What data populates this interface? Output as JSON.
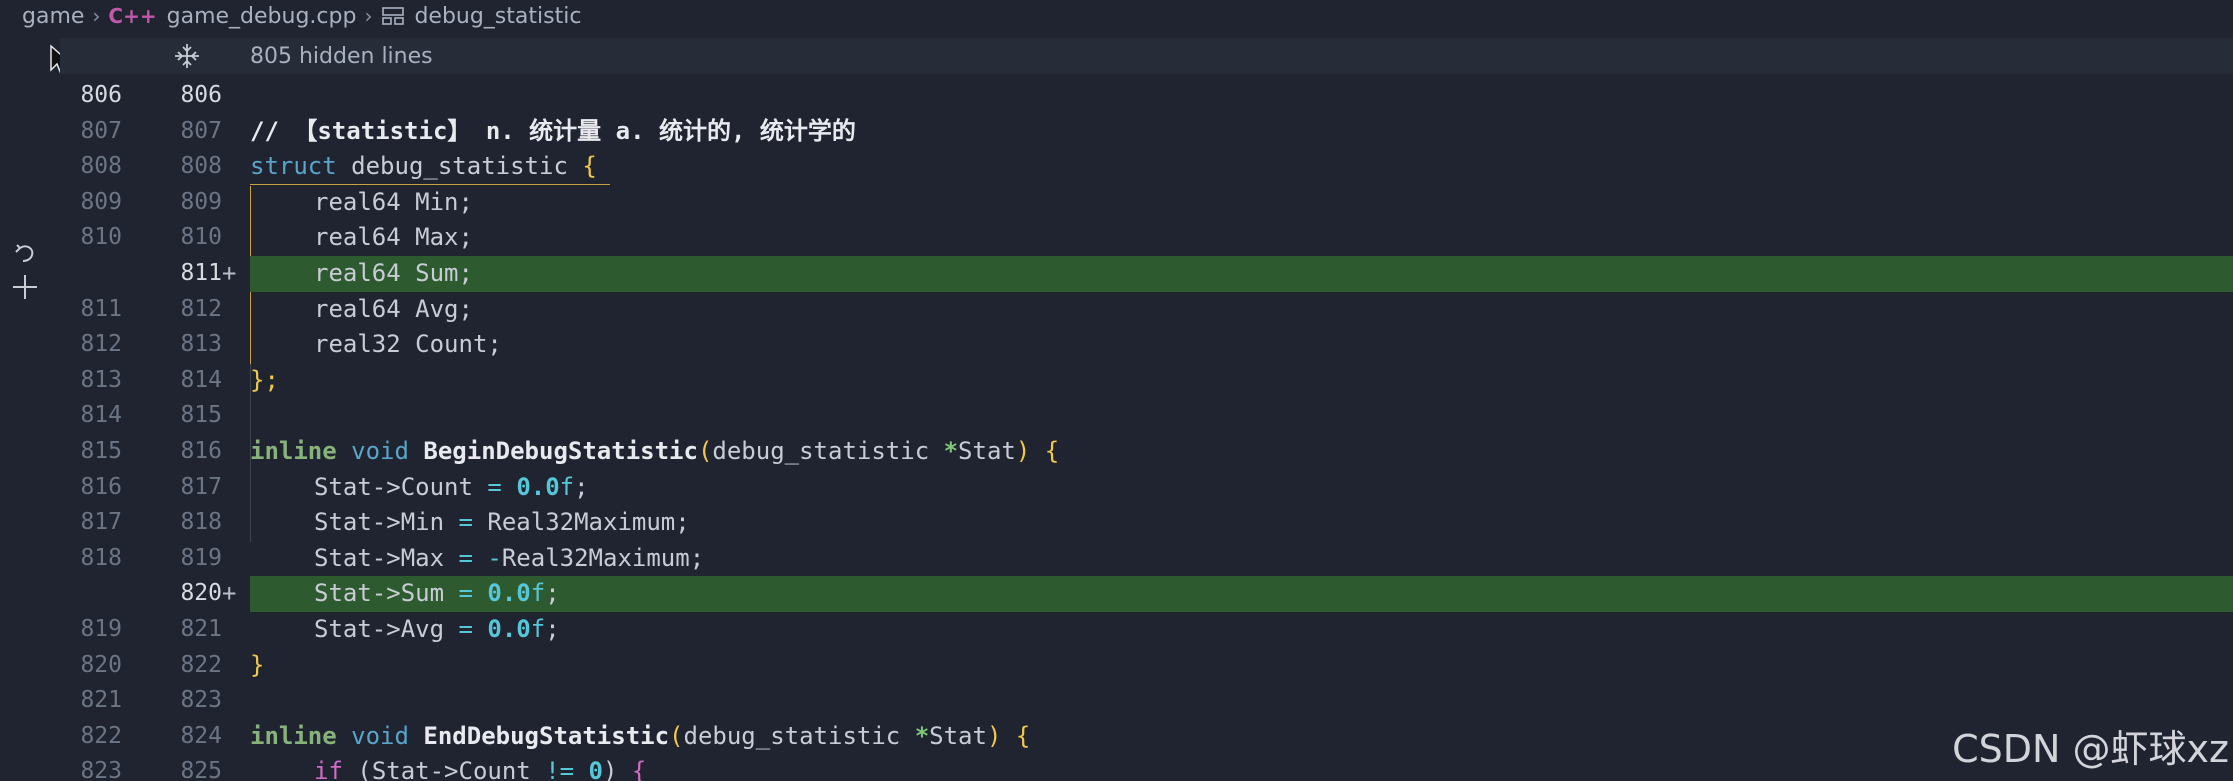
{
  "breadcrumb": {
    "folder": "game",
    "file": "game_debug.cpp",
    "file_icon_text": "C++",
    "symbol": "debug_statistic"
  },
  "hidden_lines": {
    "label": "805 hidden lines"
  },
  "watermark": "CSDN @虾球xz",
  "colors": {
    "background": "#1f2430",
    "added_line": "#2d5a2f",
    "keyword": "#5ba4c9",
    "brace": "#f2c94c"
  },
  "lines": [
    {
      "old": "806",
      "new": "806",
      "added": false,
      "current": true
    },
    {
      "old": "807",
      "new": "807",
      "added": false
    },
    {
      "old": "808",
      "new": "808",
      "added": false
    },
    {
      "old": "809",
      "new": "809",
      "added": false
    },
    {
      "old": "810",
      "new": "810",
      "added": false
    },
    {
      "old": "",
      "new": "811",
      "added": true,
      "plus": "+"
    },
    {
      "old": "811",
      "new": "812",
      "added": false
    },
    {
      "old": "812",
      "new": "813",
      "added": false
    },
    {
      "old": "813",
      "new": "814",
      "added": false
    },
    {
      "old": "814",
      "new": "815",
      "added": false
    },
    {
      "old": "815",
      "new": "816",
      "added": false
    },
    {
      "old": "816",
      "new": "817",
      "added": false
    },
    {
      "old": "817",
      "new": "818",
      "added": false
    },
    {
      "old": "818",
      "new": "819",
      "added": false
    },
    {
      "old": "",
      "new": "820",
      "added": true,
      "plus": "+"
    },
    {
      "old": "819",
      "new": "821",
      "added": false
    },
    {
      "old": "820",
      "new": "822",
      "added": false
    },
    {
      "old": "821",
      "new": "823",
      "added": false
    },
    {
      "old": "822",
      "new": "824",
      "added": false
    },
    {
      "old": "823",
      "new": "825",
      "added": false
    }
  ],
  "code": {
    "l807_comment": "// 【statistic】 n. 统计量 a. 统计的, 统计学的",
    "struct_kw": "struct",
    "struct_name": " debug_statistic ",
    "open_brace": "{",
    "close_brace": "}",
    "close_struct": "};",
    "semicolon": ";",
    "real64": "real64",
    "real32": "real32",
    "field_min": " Min;",
    "field_max": " Max;",
    "field_sum": " Sum;",
    "field_avg": " Avg;",
    "field_count": " Count;",
    "inline_kw": "inline",
    "void_kw": " void ",
    "begin_fn": "BeginDebugStatistic",
    "end_fn": "EndDebugStatistic",
    "lparen": "(",
    "rparen": ")",
    "param_type": "debug_statistic ",
    "param_star": "*",
    "param_name": "Stat",
    "stat_count": "Stat->Count",
    "stat_min": "Stat->Min",
    "stat_max": "Stat->Max",
    "stat_sum": "Stat->Sum",
    "stat_avg": "Stat->Avg",
    "assign": " = ",
    "zero": "0.0",
    "f_suffix": "f",
    "real32_max": " Real32Maximum;",
    "neg_real32_max": "-",
    "real32_max2": "Real32Maximum;",
    "if_kw": "if",
    "if_cond_open": " (",
    "if_cond": "Stat->Count ",
    "neq": "!=",
    "if_zero": " 0",
    "if_close": ") ",
    "if_brace": "{"
  }
}
